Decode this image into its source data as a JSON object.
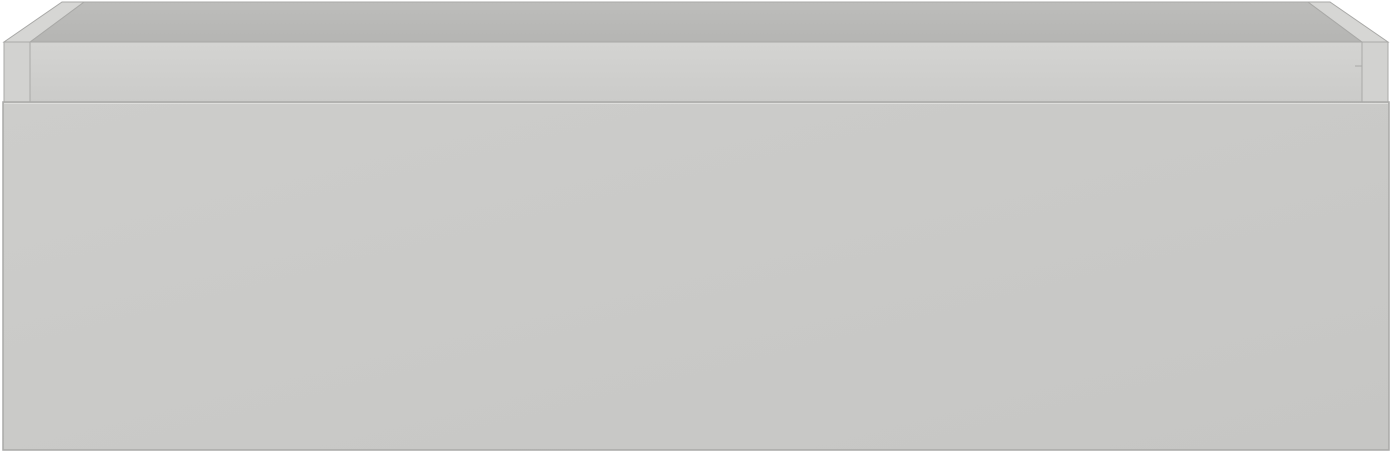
{
  "scene": {
    "subject": "drawer-box",
    "colors": {
      "background": "#ffffff",
      "front_panel": "#cacac8",
      "front_panel_edge": "#b8b8b6",
      "inner_back_wall": "#b9b9b7",
      "inner_side_wall": "#c4c4c2",
      "top_edge": "#d6d6d4",
      "back_rim": "#d2d2d0",
      "outline": "#a9a9a7"
    }
  }
}
